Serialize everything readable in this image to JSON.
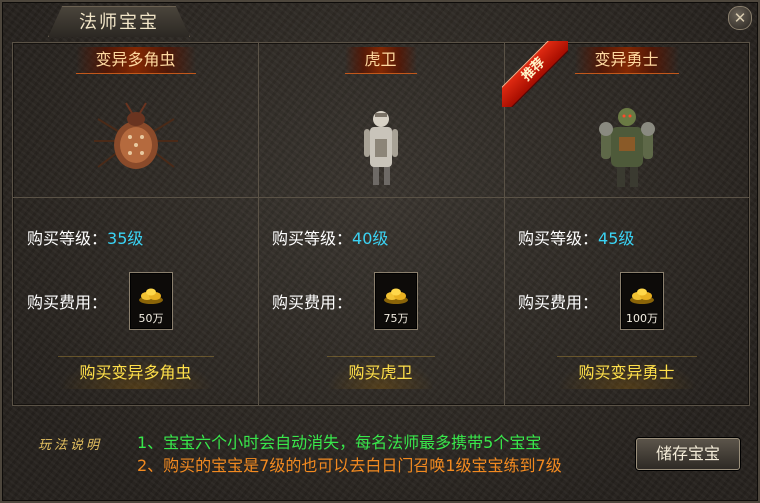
{
  "window": {
    "title": "法师宝宝",
    "close_symbol": "✕"
  },
  "labels": {
    "level": "购买等级：",
    "cost": "购买费用："
  },
  "pets": [
    {
      "name": "变异多角虫",
      "level": "35级",
      "cost": "50万",
      "buy": "购买变异多角虫",
      "badge": ""
    },
    {
      "name": "虎卫",
      "level": "40级",
      "cost": "75万",
      "buy": "购买虎卫",
      "badge": ""
    },
    {
      "name": "变异勇士",
      "level": "45级",
      "cost": "100万",
      "buy": "购买变异勇士",
      "badge": "推荐"
    }
  ],
  "footer": {
    "howto_label": "玩法说明",
    "tips": [
      "1、宝宝六个小时会自动消失，每名法师最多携带5个宝宝",
      "2、购买的宝宝是7级的也可以去白日门召唤1级宝宝练到7级"
    ],
    "store_button": "储存宝宝"
  },
  "colors": {
    "level_value": "#3ad3f4",
    "buy_text": "#ffe04a",
    "tip1": "#38e84b",
    "tip2": "#f28a20",
    "badge": "#d01a08"
  },
  "icons": {
    "currency": "gold-ingot-icon",
    "close": "close-icon"
  }
}
